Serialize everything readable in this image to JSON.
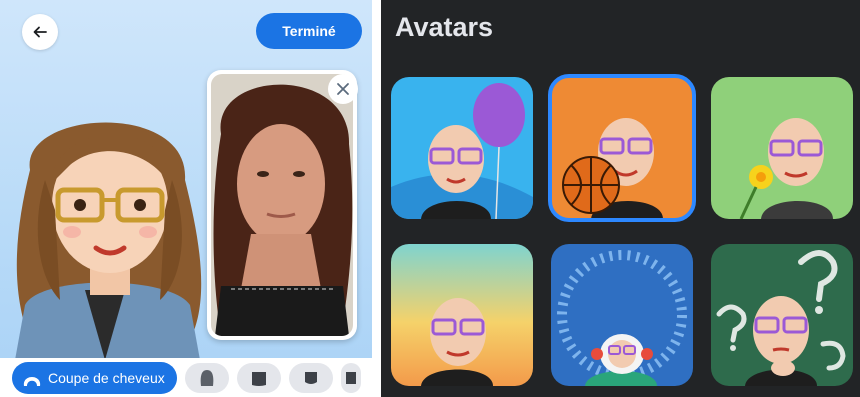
{
  "editor": {
    "done_label": "Terminé",
    "tab_label": "Coupe de cheveux",
    "icons": {
      "back": "arrow-left-icon",
      "close": "close-icon",
      "hair": "hair-icon"
    },
    "style_options": [
      "hair-style-1",
      "hair-style-2",
      "hair-style-3",
      "hair-style-4"
    ]
  },
  "gallery": {
    "title": "Avatars",
    "tiles": [
      {
        "name": "balloon",
        "selected": false
      },
      {
        "name": "basketball",
        "selected": true
      },
      {
        "name": "flower",
        "selected": false
      },
      {
        "name": "sunset",
        "selected": false
      },
      {
        "name": "snow",
        "selected": false
      },
      {
        "name": "thinking",
        "selected": false
      }
    ]
  },
  "colors": {
    "accent": "#1b74e4",
    "selected_outline": "#2d88ff",
    "dark_bg": "#222426"
  }
}
